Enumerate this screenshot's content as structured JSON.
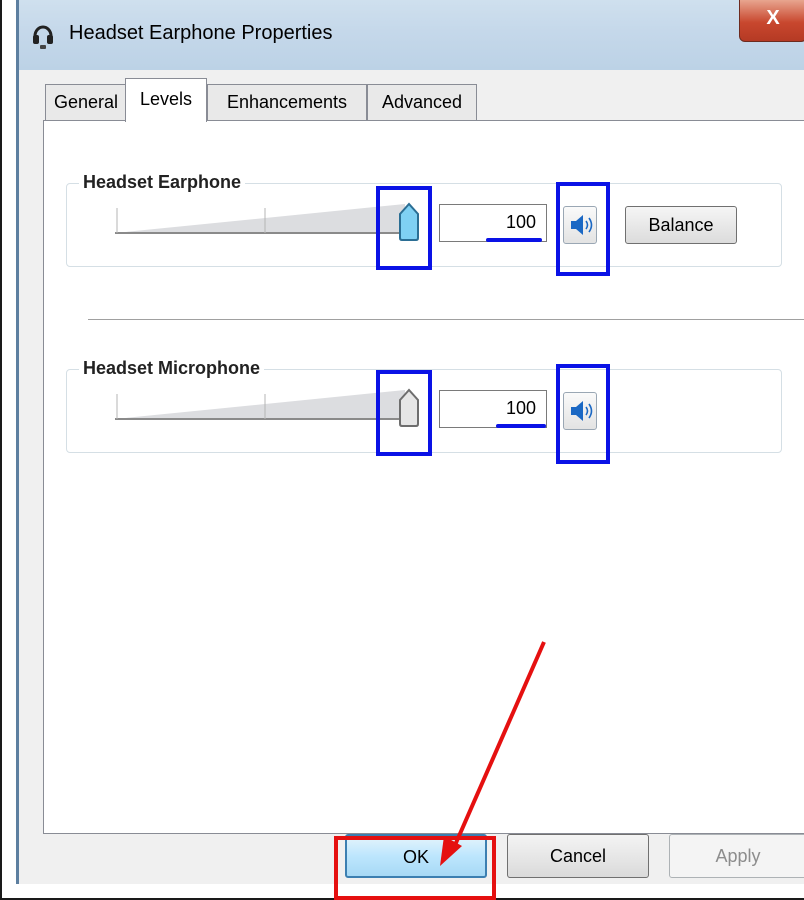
{
  "window": {
    "title": "Headset Earphone Properties",
    "close_label": "X"
  },
  "tabs": [
    {
      "label": "General",
      "active": false
    },
    {
      "label": "Levels",
      "active": true
    },
    {
      "label": "Enhancements",
      "active": false
    },
    {
      "label": "Advanced",
      "active": false
    }
  ],
  "levels": {
    "earphone": {
      "label": "Headset Earphone",
      "value": "100",
      "slider_level_percent": 100,
      "balance_label": "Balance",
      "mute_icon": "speaker-icon"
    },
    "microphone": {
      "label": "Headset Microphone",
      "value": "100",
      "slider_level_percent": 100,
      "mute_icon": "speaker-icon"
    }
  },
  "buttons": {
    "ok": "OK",
    "cancel": "Cancel",
    "apply": "Apply"
  },
  "colors": {
    "annotation_blue": "#0a12e6",
    "annotation_red": "#e51010",
    "default_button": "#bde6fd"
  }
}
